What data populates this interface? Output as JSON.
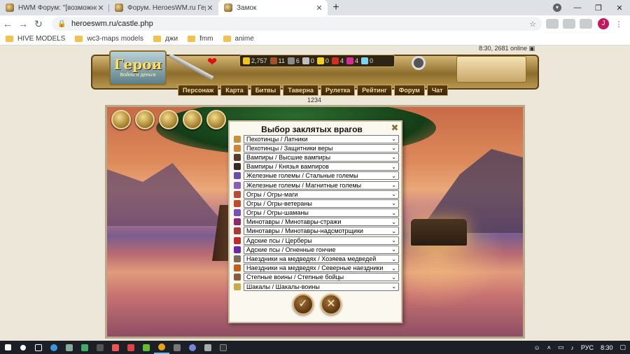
{
  "browser": {
    "tabs": [
      {
        "title": "HWM Форум: \"[возможно баг]"
      },
      {
        "title": "Форум. HeroesWM.ru Герон во"
      },
      {
        "title": "Замок"
      }
    ],
    "url": "heroeswm.ru/castle.php",
    "profile_initial": "J",
    "bookmarks": [
      "HIVE MODELS",
      "wc3-maps models",
      "джи",
      "fmm",
      "anime"
    ]
  },
  "game": {
    "logo_title": "Герои",
    "logo_subtitle": "Войны и деньги",
    "server_status": "8:30, 2681 online",
    "resources": [
      "2,757",
      "11",
      "6",
      "0",
      "0",
      "4",
      "4",
      "0"
    ],
    "resource_colors": [
      "#f0c419",
      "#a0522d",
      "#8b8b8b",
      "#c0c0c0",
      "#f5d020",
      "#d62d20",
      "#d62d9a",
      "#7fd3f0"
    ],
    "menu": [
      "Персонаж",
      "Карта",
      "Битвы",
      "Таверна",
      "Рулетка",
      "Рейтинг",
      "Форум",
      "Чат"
    ],
    "counter": "1234"
  },
  "dialog": {
    "title": "Выбор заклятых врагов",
    "rows": [
      {
        "value": "Пехотинцы / Латники",
        "icon_color": "#c98f3a"
      },
      {
        "value": "Пехотинцы / Защитники веры",
        "icon_color": "#c9873a"
      },
      {
        "value": "Вампиры / Высшие вампиры",
        "icon_color": "#5a3a2a"
      },
      {
        "value": "Вампиры / Князья вампиров",
        "icon_color": "#3a2a22"
      },
      {
        "value": "Железные големы / Стальные големы",
        "icon_color": "#6a4fa8"
      },
      {
        "value": "Железные големы / Магнитные големы",
        "icon_color": "#8a5fb8"
      },
      {
        "value": "Огры / Огры-маги",
        "icon_color": "#b84a3a"
      },
      {
        "value": "Огры / Огры-ветераны",
        "icon_color": "#c04a2a"
      },
      {
        "value": "Огры / Огры-шаманы",
        "icon_color": "#7a4fb8"
      },
      {
        "value": "Минотавры / Минотавры-стражи",
        "icon_color": "#8a2a6a"
      },
      {
        "value": "Минотавры / Минотавры-надсмотрщики",
        "icon_color": "#a83a3a"
      },
      {
        "value": "Адские псы / Церберы",
        "icon_color": "#c02a2a"
      },
      {
        "value": "Адские псы / Огненные гончие",
        "icon_color": "#6a2aa8"
      },
      {
        "value": "Наездники на медведях / Хозяева медведей",
        "icon_color": "#7a6a5a"
      },
      {
        "value": "Наездники на медведях / Северные наездники",
        "icon_color": "#c0601a"
      },
      {
        "value": "Степные воины / Степные бойцы",
        "icon_color": "#8a5a3a"
      },
      {
        "value": "Шакалы / Шакалы-воины",
        "icon_color": "#c9a84a"
      }
    ],
    "ok_symbol": "✓",
    "cancel_symbol": "✕",
    "close_symbol": "✖"
  },
  "taskbar": {
    "lang": "РУС",
    "time": "8:30"
  }
}
